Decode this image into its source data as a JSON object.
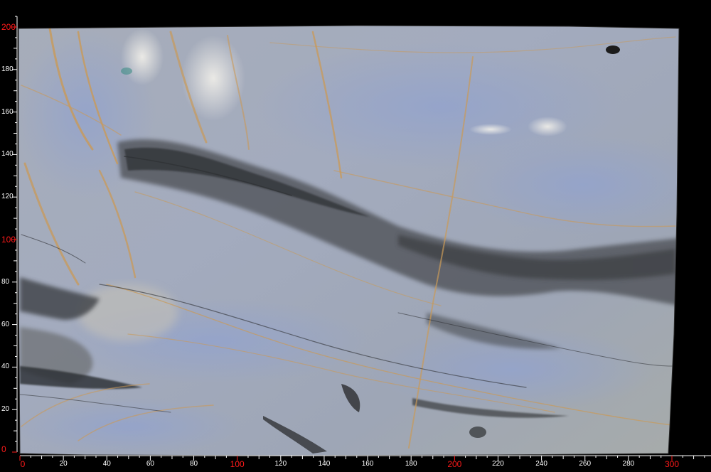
{
  "scale": {
    "x_ticks": [
      "0",
      "20",
      "40",
      "60",
      "80",
      "100",
      "120",
      "140",
      "160",
      "180",
      "200",
      "220",
      "240",
      "260",
      "280",
      "300"
    ],
    "y_ticks": [
      "0",
      "20",
      "40",
      "60",
      "80",
      "100",
      "120",
      "140",
      "160",
      "180",
      "200"
    ],
    "x_highlight_ticks": [
      "0",
      "100",
      "200",
      "300"
    ],
    "y_highlight_ticks": [
      "0",
      "100",
      "200"
    ],
    "x_max": 320,
    "y_max": 205
  },
  "colors": {
    "background": "#000000",
    "ruler": "#ffffff",
    "ruler_highlight": "#ff1a1a",
    "slab_base": "#a8aebb",
    "slab_blue": "#98a6c6",
    "slab_dark": "#4a4d52",
    "vein_gold": "#c89a58",
    "vein_dark": "#2e3033",
    "highlight": "#e8e6e0"
  }
}
